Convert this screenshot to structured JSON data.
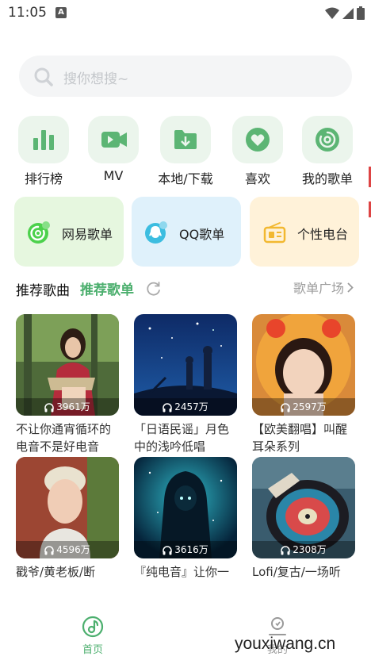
{
  "status_bar": {
    "time": "11:05",
    "notification_glyph": "A"
  },
  "search": {
    "placeholder": "搜你想搜~"
  },
  "quick_actions": [
    {
      "label": "排行榜",
      "icon": "bar-chart-icon"
    },
    {
      "label": "MV",
      "icon": "video-camera-icon"
    },
    {
      "label": "本地/下载",
      "icon": "folder-download-icon"
    },
    {
      "label": "喜欢",
      "icon": "heart-icon"
    },
    {
      "label": "我的歌单",
      "icon": "disc-icon"
    }
  ],
  "categories": [
    {
      "label": "网易歌单",
      "icon": "netease-icon",
      "color": "#e6f7df"
    },
    {
      "label": "QQ歌单",
      "icon": "qq-icon",
      "color": "#dff1fb"
    },
    {
      "label": "个性电台",
      "icon": "radio-icon",
      "color": "#fff2d9"
    }
  ],
  "section": {
    "tab_recommend_songs": "推荐歌曲",
    "tab_recommend_playlists": "推荐歌单",
    "more": "歌单广场"
  },
  "playlists": [
    {
      "count": "3961万",
      "title": "不让你通宵循环的电音不是好电音"
    },
    {
      "count": "2457万",
      "title": "「日语民谣」月色中的浅吟低唱"
    },
    {
      "count": "2597万",
      "title": "【欧美翻唱】叫醒耳朵系列"
    },
    {
      "count": "4596万",
      "title": "戳爷/黄老板/断"
    },
    {
      "count": "3616万",
      "title": "『纯电音』让你一"
    },
    {
      "count": "2308万",
      "title": "Lofi/复古/一场听"
    }
  ],
  "bottom_nav": [
    {
      "label": "首页",
      "icon": "home-music-icon",
      "active": true
    },
    {
      "label": "我的",
      "icon": "profile-icon",
      "active": false
    }
  ],
  "watermark": "youxiwang.cn",
  "colors": {
    "accent": "#4caf6e",
    "icon_green": "#5cb574",
    "nav_inactive": "#999999"
  }
}
